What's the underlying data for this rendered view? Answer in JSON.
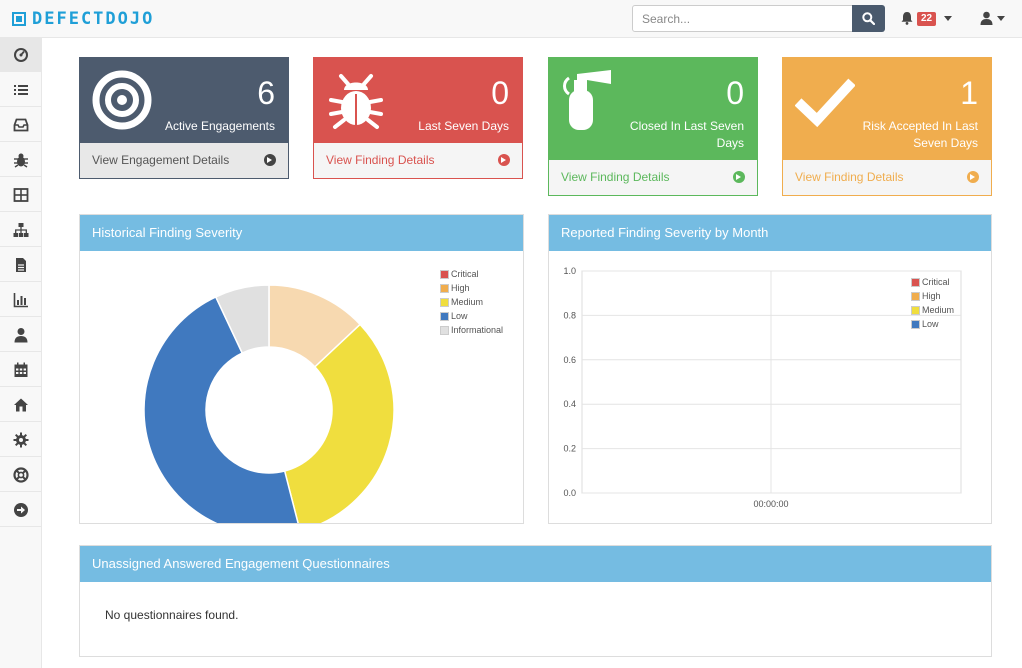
{
  "brand": {
    "name": "DEFECTDOJO",
    "color": "#1f9fd7"
  },
  "search": {
    "placeholder": "Search..."
  },
  "notifications": {
    "count": "22"
  },
  "sidebar": {
    "items": [
      {
        "name": "dashboard",
        "icon": "tachometer-icon"
      },
      {
        "name": "products",
        "icon": "list-icon"
      },
      {
        "name": "engagements",
        "icon": "inbox-icon"
      },
      {
        "name": "findings",
        "icon": "bug-icon"
      },
      {
        "name": "components",
        "icon": "grid-icon"
      },
      {
        "name": "endpoints",
        "icon": "sitemap-icon"
      },
      {
        "name": "reports",
        "icon": "file-icon"
      },
      {
        "name": "metrics",
        "icon": "bar-chart-icon"
      },
      {
        "name": "users",
        "icon": "user-icon"
      },
      {
        "name": "calendar",
        "icon": "calendar-icon"
      },
      {
        "name": "questionnaires",
        "icon": "house-icon"
      },
      {
        "name": "configuration",
        "icon": "gear-icon"
      },
      {
        "name": "help",
        "icon": "life-ring-icon"
      },
      {
        "name": "logout",
        "icon": "arrow-circle-icon"
      }
    ]
  },
  "stats": {
    "engagements": {
      "value": "6",
      "label": "Active Engagements",
      "link": "View Engagement Details",
      "color": "#4d5b6e"
    },
    "seven_days": {
      "value": "0",
      "label": "Last Seven Days",
      "link": "View Finding Details",
      "color": "#d9534f"
    },
    "closed": {
      "value": "0",
      "label": "Closed In Last Seven Days",
      "link": "View Finding Details",
      "color": "#5cb85c"
    },
    "risk": {
      "value": "1",
      "label": "Risk Accepted In Last Seven Days",
      "link": "View Finding Details",
      "color": "#f0ad4e"
    }
  },
  "historical": {
    "title": "Historical Finding Severity",
    "chart_data": {
      "type": "pie",
      "categories": [
        "Critical",
        "High",
        "Medium",
        "Low",
        "Informational"
      ],
      "colors": [
        "#d9534f",
        "#f0ad4e",
        "#f0de3e",
        "#4079bf",
        "#e0e0e0"
      ],
      "slice_colors": [
        "#f7d9b0",
        "#f0de3e",
        "#4079bf",
        "#e0e0e0"
      ],
      "slices": [
        13,
        33,
        47,
        7
      ],
      "legend": "top-right"
    }
  },
  "monthly": {
    "title": "Reported Finding Severity by Month",
    "chart_data": {
      "type": "line",
      "x": [
        "00:00:00"
      ],
      "yticks": [
        "1.0",
        "0.8",
        "0.6",
        "0.4",
        "0.2",
        "0.0"
      ],
      "ylim": [
        0,
        1
      ],
      "series": [
        {
          "name": "Critical",
          "color": "#d9534f"
        },
        {
          "name": "High",
          "color": "#f0ad4e"
        },
        {
          "name": "Medium",
          "color": "#f0de3e"
        },
        {
          "name": "Low",
          "color": "#4079bf"
        }
      ],
      "grid": true,
      "legend": "top-right"
    }
  },
  "questionnaires": {
    "title": "Unassigned Answered Engagement Questionnaires",
    "empty": "No questionnaires found."
  }
}
